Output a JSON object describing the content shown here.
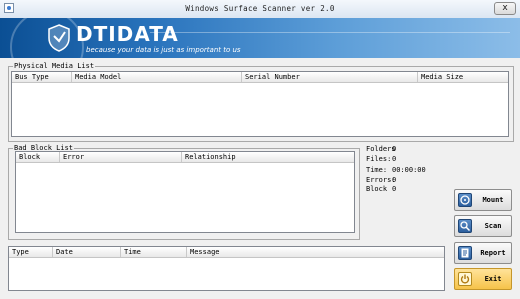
{
  "window": {
    "title": "Windows Surface Scanner ver 2.0",
    "close_label": "x"
  },
  "banner": {
    "logo": "DTIDATA",
    "tagline": "because your data is just as important to us"
  },
  "physical_media": {
    "legend": "Physical Media List",
    "columns": [
      "Bus Type",
      "Media Model",
      "Serial Number",
      "Media Size"
    ]
  },
  "bad_block": {
    "legend": "Bad Block List",
    "columns": [
      "Block",
      "Error",
      "Relationship"
    ]
  },
  "stats": {
    "folders_label": "Folders",
    "folders_value": "0",
    "files_label": "Files:",
    "files_value": "0",
    "time_label": "Time:",
    "time_value": "00:00:00",
    "errors_label": "Errors:",
    "errors_value": "0",
    "block_label": "Block",
    "block_value": "0"
  },
  "log": {
    "columns": [
      "Type",
      "Date",
      "Time",
      "Message"
    ]
  },
  "buttons": {
    "mount": "Mount",
    "scan": "Scan",
    "report": "Report",
    "exit": "Exit"
  },
  "icons": [
    "app-icon",
    "mount-icon",
    "scan-icon",
    "report-icon",
    "exit-icon"
  ],
  "colors": {
    "banner_dark": "#0b4f94",
    "banner_light": "#8cbde8",
    "exit_button": "#f6c34a"
  }
}
